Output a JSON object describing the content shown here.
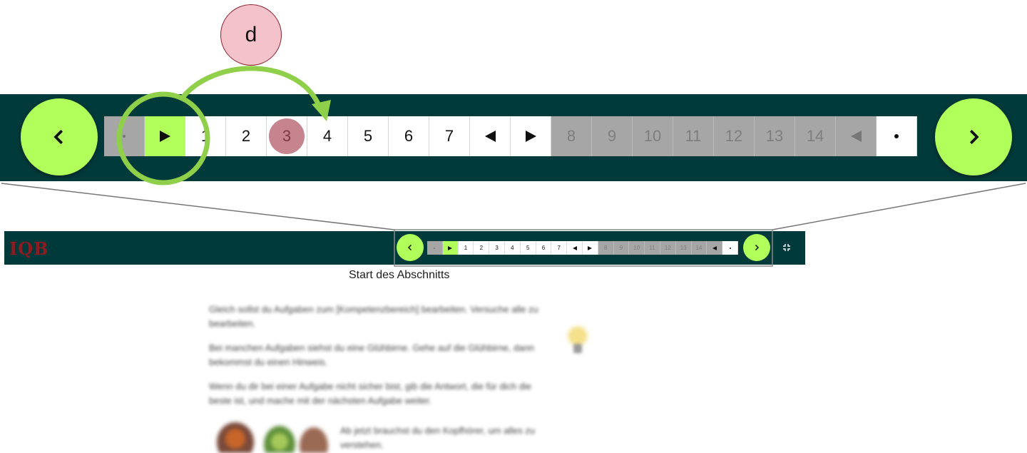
{
  "annotation": {
    "label": "d"
  },
  "navigation": {
    "prev_icon": "chevron-left-icon",
    "next_icon": "chevron-right-icon",
    "strip": [
      {
        "kind": "dot",
        "state": "inactive"
      },
      {
        "kind": "play",
        "state": "active"
      },
      {
        "kind": "number",
        "label": "1",
        "state": "normal"
      },
      {
        "kind": "number",
        "label": "2",
        "state": "normal"
      },
      {
        "kind": "number",
        "label": "3",
        "state": "current"
      },
      {
        "kind": "number",
        "label": "4",
        "state": "normal"
      },
      {
        "kind": "number",
        "label": "5",
        "state": "normal"
      },
      {
        "kind": "number",
        "label": "6",
        "state": "normal"
      },
      {
        "kind": "number",
        "label": "7",
        "state": "normal"
      },
      {
        "kind": "back",
        "state": "normal"
      },
      {
        "kind": "play",
        "state": "normal"
      },
      {
        "kind": "number",
        "label": "8",
        "state": "inactive"
      },
      {
        "kind": "number",
        "label": "9",
        "state": "inactive"
      },
      {
        "kind": "number",
        "label": "10",
        "state": "inactive"
      },
      {
        "kind": "number",
        "label": "11",
        "state": "inactive"
      },
      {
        "kind": "number",
        "label": "12",
        "state": "inactive"
      },
      {
        "kind": "number",
        "label": "13",
        "state": "inactive"
      },
      {
        "kind": "number",
        "label": "14",
        "state": "inactive"
      },
      {
        "kind": "back",
        "state": "inactive"
      },
      {
        "kind": "dot",
        "state": "normal"
      }
    ]
  },
  "header": {
    "logo": "IQB",
    "exit_fullscreen_icon": "exit-fullscreen-icon"
  },
  "section_label": "Start des Abschnitts",
  "content": {
    "paragraphs": [
      "Gleich sollst du Aufgaben zum [Kompetenzbereich] bearbeiten. Versuche alle zu bearbeiten.",
      "Bei manchen Aufgaben siehst du eine Glühbirne. Gehe auf die Glühbirne, dann bekommst du einen Hinweis.",
      "Wenn du dir bei einer Aufgabe nicht sicher bist, gib die Antwort, die für dich die beste ist, und mache mit der nächsten Aufgabe weiter."
    ],
    "audio_hint": "Ab jetzt brauchst du den Kopfhörer, um alles zu verstehen.",
    "hint_icon": "lightbulb-icon"
  },
  "colors": {
    "bar": "#003a3a",
    "accent": "#b0ff5a",
    "inactive": "#a6a6a6",
    "current": "#c6858e",
    "highlight_ring": "#8fcf4a"
  }
}
